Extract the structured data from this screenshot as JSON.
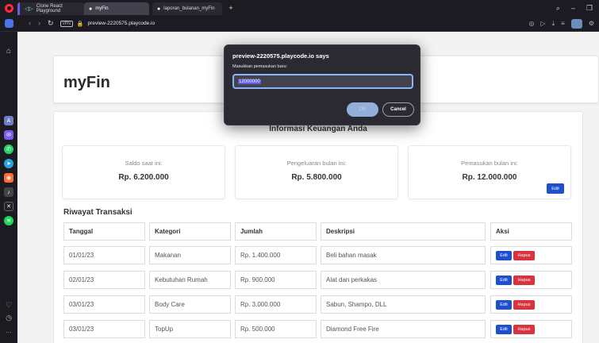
{
  "browser": {
    "tabs": [
      {
        "label": "Clone React Playground"
      },
      {
        "label": "myFin"
      },
      {
        "label": "laporan_bulanan_myFin"
      }
    ],
    "url_host": "preview-2220575.playcode.io",
    "vpn_label": "VPN"
  },
  "page": {
    "brand": "myFin",
    "info_title": "Informasi Keuangan Anda",
    "stats": [
      {
        "label": "Saldo saat ini:",
        "value": "Rp. 6.200.000"
      },
      {
        "label": "Pengeluaran bulan ini:",
        "value": "Rp. 5.800.000"
      },
      {
        "label": "Pemasukan bulan ini:",
        "value": "Rp. 12.000.000",
        "edit_label": "Edit"
      }
    ],
    "history_title": "Riwayat Transaksi",
    "table": {
      "headers": [
        "Tanggal",
        "Kategori",
        "Jumlah",
        "Deskripsi",
        "Aksi"
      ],
      "rows": [
        [
          "01/01/23",
          "Makanan",
          "Rp. 1.400.000",
          "Beli bahan masak"
        ],
        [
          "02/01/23",
          "Kebutuhan Rumah",
          "Rp. 900.000",
          "Alat dan perkakas"
        ],
        [
          "03/01/23",
          "Body Care",
          "Rp. 3.000.000",
          "Sabun, Shampo, DLL"
        ],
        [
          "03/01/23",
          "TopUp",
          "Rp. 500.000",
          "Diamond Free Fire"
        ]
      ],
      "edit_label": "Edit",
      "delete_label": "Hapus"
    }
  },
  "dialog": {
    "title": "preview-2220575.playcode.io says",
    "message": "Masukkan pemasukan baru:",
    "input_value": "12000000",
    "ok_label": "OK",
    "cancel_label": "Cancel"
  },
  "colors": {
    "primary": "#1d4fcf",
    "danger": "#d9333f",
    "dialog_bg": "#2b2a33"
  }
}
